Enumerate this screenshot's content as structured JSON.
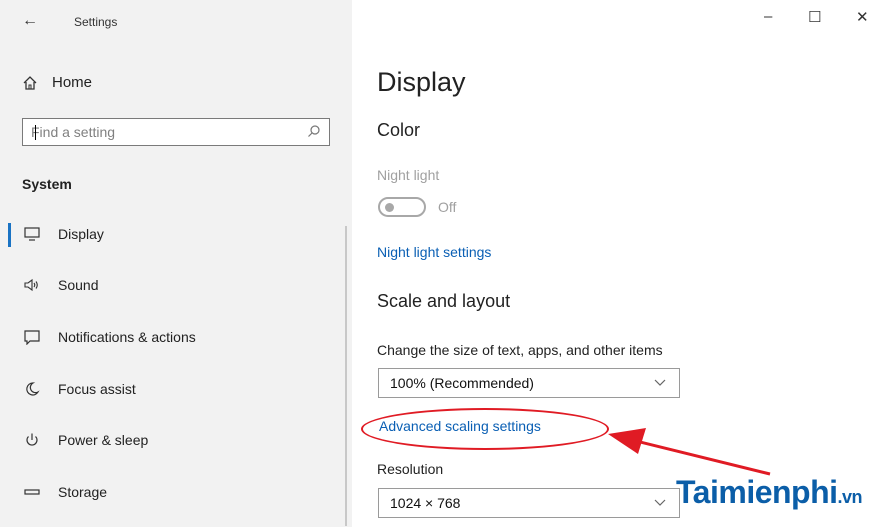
{
  "window": {
    "back_glyph": "←",
    "title": "Settings",
    "minimize_glyph": "–",
    "maximize_glyph": "☐",
    "close_glyph": "✕"
  },
  "sidebar": {
    "home_label": "Home",
    "home_icon": "home-icon",
    "search_placeholder": "Find a setting",
    "search_icon": "search-icon",
    "section_title": "System",
    "items": [
      {
        "label": "Display",
        "icon": "monitor-icon",
        "glyph": "▭",
        "active": true
      },
      {
        "label": "Sound",
        "icon": "speaker-icon",
        "glyph": "🕪",
        "active": false
      },
      {
        "label": "Notifications & actions",
        "icon": "notification-icon",
        "glyph": "▢",
        "active": false
      },
      {
        "label": "Focus assist",
        "icon": "moon-icon",
        "glyph": "☽",
        "active": false
      },
      {
        "label": "Power & sleep",
        "icon": "power-icon",
        "glyph": "⏻",
        "active": false
      },
      {
        "label": "Storage",
        "icon": "storage-icon",
        "glyph": "▭",
        "active": false
      }
    ]
  },
  "main": {
    "page_title": "Display",
    "color_heading": "Color",
    "night_light_label": "Night light",
    "night_light_state": "Off",
    "night_light_link": "Night light settings",
    "scale_heading": "Scale and layout",
    "scale_desc": "Change the size of text, apps, and other items",
    "scale_value": "100% (Recommended)",
    "advanced_link": "Advanced scaling settings",
    "resolution_label": "Resolution",
    "resolution_value": "1024 × 768"
  },
  "annotation": {
    "color": "#e01b24"
  },
  "watermark": {
    "text": "Taimienphi",
    "suffix": ".vn",
    "color": "#0b5ea8"
  },
  "colors": {
    "accent": "#1a73c4",
    "link": "#0a5fb4",
    "sidebar_bg": "#f2f2f2"
  }
}
